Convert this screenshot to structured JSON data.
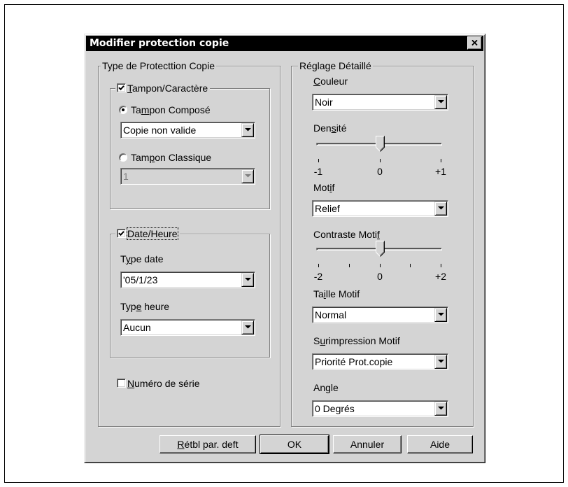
{
  "dialog": {
    "title": "Modifier protection copie"
  },
  "left_group": {
    "title": "Type de Protecttion Copie",
    "stamp": {
      "label": "Tampon/Caractère",
      "checked": true,
      "composite": {
        "label": "Tampon Composé",
        "selected": true,
        "value": "Copie non valide"
      },
      "classic": {
        "label": "Tampon Classique",
        "selected": false,
        "value": "1",
        "disabled": true
      }
    },
    "date_time": {
      "label": "Date/Heure",
      "checked": true,
      "date_type": {
        "label": "Type date",
        "value": "'05/1/23"
      },
      "time_type": {
        "label": "Type heure",
        "value": "Aucun"
      }
    },
    "serial_number": {
      "label": "Numéro de série",
      "checked": false
    }
  },
  "right_group": {
    "title": "Réglage Détaillé",
    "color": {
      "label": "Couleur",
      "value": "Noir"
    },
    "density": {
      "label": "Densité",
      "min": -1,
      "max": 1,
      "step": 1,
      "value": 0,
      "tick_labels": [
        "-1",
        "0",
        "+1"
      ]
    },
    "pattern": {
      "label": "Motif",
      "value": "Relief"
    },
    "pattern_contrast": {
      "label": "Contraste Motif",
      "min": -2,
      "max": 2,
      "step": 1,
      "value": 0,
      "tick_labels": [
        "-2",
        "0",
        "+2"
      ]
    },
    "pattern_size": {
      "label": "Taille Motif",
      "value": "Normal"
    },
    "pattern_overprint": {
      "label": "Surimpression Motif",
      "value": "Priorité Prot.copie"
    },
    "angle": {
      "label": "Angle",
      "value": "0 Degrés"
    }
  },
  "buttons": {
    "reset": "Rétbl par. deft",
    "ok": "OK",
    "cancel": "Annuler",
    "help": "Aide"
  },
  "icons": {
    "close": "close-icon",
    "dropdown": "chevron-down-icon",
    "check": "check-icon",
    "radio": "radio-dot-icon",
    "slider_thumb": "slider-thumb-icon"
  },
  "colors": {
    "title_bar": "#000000",
    "title_text": "#ffffff",
    "dialog_bg": "#d4d4d4",
    "field_bg": "#ffffff",
    "disabled_text": "#808080"
  }
}
